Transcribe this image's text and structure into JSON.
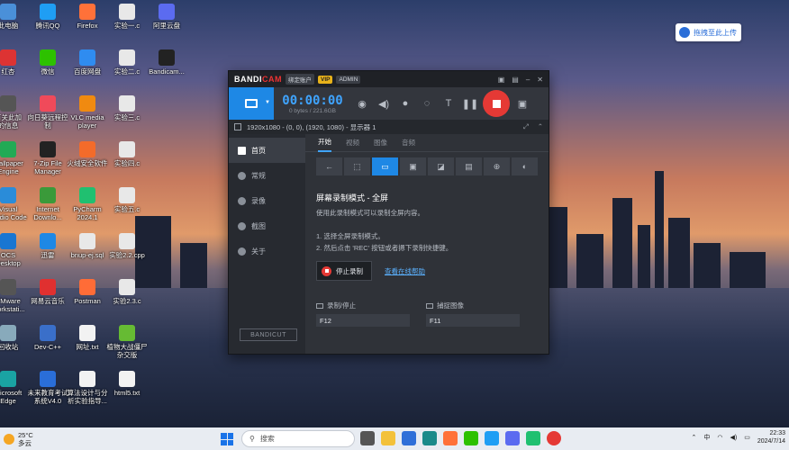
{
  "desktop_icons": [
    {
      "label": "此电脑",
      "col": 0,
      "row": 0,
      "color": "#4a90d9"
    },
    {
      "label": "腾讯QQ",
      "col": 1,
      "row": 0,
      "color": "#1f9ef4"
    },
    {
      "label": "Firefox",
      "col": 2,
      "row": 0,
      "color": "#ff7139"
    },
    {
      "label": "实验一.c",
      "col": 3,
      "row": 0,
      "color": "#e8e8e8"
    },
    {
      "label": "阿里云盘",
      "col": 4,
      "row": 0,
      "color": "#5b6bf0"
    },
    {
      "label": "红杏",
      "col": 0,
      "row": 1,
      "color": "#d33"
    },
    {
      "label": "微信",
      "col": 1,
      "row": 1,
      "color": "#2dc100"
    },
    {
      "label": "百度网盘",
      "col": 2,
      "row": 1,
      "color": "#2f8cf0"
    },
    {
      "label": "实验二.c",
      "col": 3,
      "row": 1,
      "color": "#e8e8e8"
    },
    {
      "label": "Bandicam...",
      "col": 4,
      "row": 1,
      "color": "#222"
    },
    {
      "label": "有关此加\n的信息",
      "col": 0,
      "row": 2,
      "color": "#555"
    },
    {
      "label": "向日葵远程控\n制",
      "col": 1,
      "row": 2,
      "color": "#f04a5a"
    },
    {
      "label": "VLC media\nplayer",
      "col": 2,
      "row": 2,
      "color": "#f08a10"
    },
    {
      "label": "实验三.c",
      "col": 3,
      "row": 2,
      "color": "#e8e8e8"
    },
    {
      "label": "Wallpaper\nEngine",
      "col": 0,
      "row": 3,
      "color": "#2a5"
    },
    {
      "label": "7-Zip File\nManager",
      "col": 1,
      "row": 3,
      "color": "#222"
    },
    {
      "label": "火绒安全软件",
      "col": 2,
      "row": 3,
      "color": "#f36b2a"
    },
    {
      "label": "实验四.c",
      "col": 3,
      "row": 3,
      "color": "#e8e8e8"
    },
    {
      "label": "Visual\nStudio Code",
      "col": 0,
      "row": 4,
      "color": "#2a8cd9"
    },
    {
      "label": "Internet\nDownlo...",
      "col": 1,
      "row": 4,
      "color": "#3a9a3a"
    },
    {
      "label": "PyCharm\n2024.1",
      "col": 2,
      "row": 4,
      "color": "#20c070"
    },
    {
      "label": "实验五.c",
      "col": 3,
      "row": 4,
      "color": "#e8e8e8"
    },
    {
      "label": "OCS\nDesktop",
      "col": 0,
      "row": 5,
      "color": "#1976d2"
    },
    {
      "label": "迅雷",
      "col": 1,
      "row": 5,
      "color": "#1e88e5"
    },
    {
      "label": "bnup-ej.sql",
      "col": 2,
      "row": 5,
      "color": "#e8e8e8"
    },
    {
      "label": "实验2.2.cpp",
      "col": 3,
      "row": 5,
      "color": "#e8e8e8"
    },
    {
      "label": "VMware\nWorkstati...",
      "col": 0,
      "row": 6,
      "color": "#555"
    },
    {
      "label": "网易云音乐",
      "col": 1,
      "row": 6,
      "color": "#e03030"
    },
    {
      "label": "Postman",
      "col": 2,
      "row": 6,
      "color": "#ff6c37"
    },
    {
      "label": "实验2.3.c",
      "col": 3,
      "row": 6,
      "color": "#e8e8e8"
    },
    {
      "label": "回收站",
      "col": 0,
      "row": 7,
      "color": "#8ab"
    },
    {
      "label": "Dev-C++",
      "col": 1,
      "row": 7,
      "color": "#3a6fc9"
    },
    {
      "label": "网址.txt",
      "col": 2,
      "row": 7,
      "color": "#f2f2f2"
    },
    {
      "label": "植物大战僵尸\n杂交版",
      "col": 3,
      "row": 7,
      "color": "#6b3"
    },
    {
      "label": "Microsoft\nEdge",
      "col": 0,
      "row": 8,
      "color": "#1aa3a3"
    },
    {
      "label": "未来教育考试\n系统V4.0",
      "col": 1,
      "row": 8,
      "color": "#2a6ed8"
    },
    {
      "label": "算法设计与分\n析实验指导...",
      "col": 2,
      "row": 8,
      "color": "#f2f2f2"
    },
    {
      "label": "html5.txt",
      "col": 3,
      "row": 8,
      "color": "#f2f2f2"
    }
  ],
  "cloud_upload": "拖拽至此上传",
  "bandicam": {
    "logo_a": "BANDI",
    "logo_b": "CAM",
    "badge_mode": "绑定账户",
    "badge_vip": "VIP",
    "badge_admin": "ADMIN",
    "timer": "00:00:00",
    "size": "0 bytes / 221.6GB",
    "info": "1920x1080 - (0, 0), (1920, 1080) - 显示器 1",
    "sidebar": [
      {
        "label": "首页",
        "icon": "home-icon",
        "active": true
      },
      {
        "label": "常规",
        "icon": "gear-icon",
        "active": false
      },
      {
        "label": "录像",
        "icon": "video-icon",
        "active": false
      },
      {
        "label": "截图",
        "icon": "image-icon",
        "active": false
      },
      {
        "label": "关于",
        "icon": "info-icon",
        "active": false
      }
    ],
    "bandicut": "BANDICUT",
    "tabs": [
      {
        "label": "开始",
        "active": true
      },
      {
        "label": "视频",
        "active": false
      },
      {
        "label": "图像",
        "active": false
      },
      {
        "label": "音频",
        "active": false
      }
    ],
    "section_title": "屏幕录制模式 - 全屏",
    "section_desc": "使用此录制模式可以录制全屏内容。",
    "step1": "1. 选择全屏录制模式。",
    "step2": "2. 然后点击 'REC' 按钮或者摁下录制快捷键。",
    "stop_label": "停止录制",
    "help_link": "查看在线帮助",
    "hotkey1_label": "录制/停止",
    "hotkey1_value": "F12",
    "hotkey2_label": "捕捉图像",
    "hotkey2_value": "F11"
  },
  "taskbar": {
    "temp": "25°C",
    "weather": "多云",
    "search_placeholder": "搜索",
    "time": "22:33",
    "date": "2024/7/14",
    "lang": "中"
  }
}
